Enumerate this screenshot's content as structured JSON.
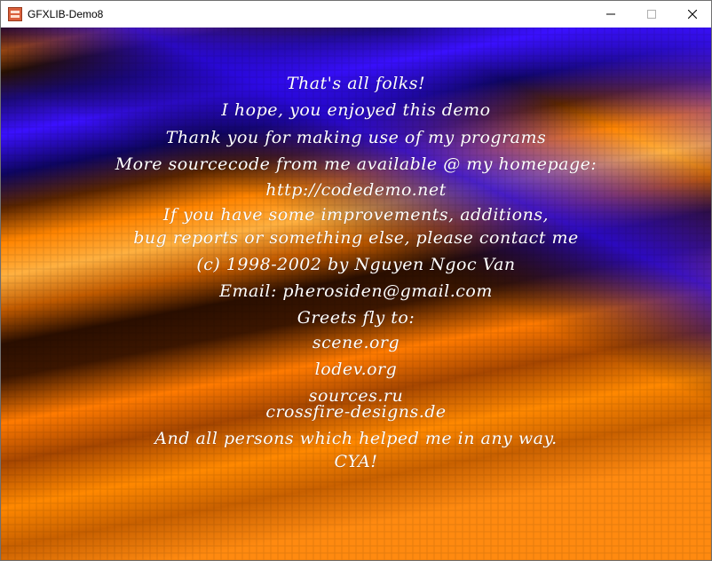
{
  "window": {
    "title": "GFXLIB-Demo8",
    "app_icon": "gfxlib-app-icon",
    "controls": {
      "minimize_icon": "minimize-icon",
      "maximize_icon": "maximize-icon",
      "close_icon": "close-icon"
    }
  },
  "colors": {
    "orange": "#ff7f00",
    "blue": "#3a10ff",
    "dark": "#000000",
    "text": "#ffffff"
  },
  "credits": {
    "lines": [
      "That's all folks!",
      "I hope, you enjoyed this demo",
      "Thank you for making use of my programs",
      "More sourcecode from me available @ my homepage:",
      "http://codedemo.net",
      "If you have some improvements, additions,",
      "bug reports or something else, please contact me",
      "(c) 1998-2002 by Nguyen Ngoc Van",
      "Email: pherosiden@gmail.com",
      "Greets fly to:",
      "scene.org",
      "lodev.org",
      "sources.ru",
      "crossfire-designs.de",
      "And all persons which helped me in any way.",
      "CYA!"
    ]
  }
}
